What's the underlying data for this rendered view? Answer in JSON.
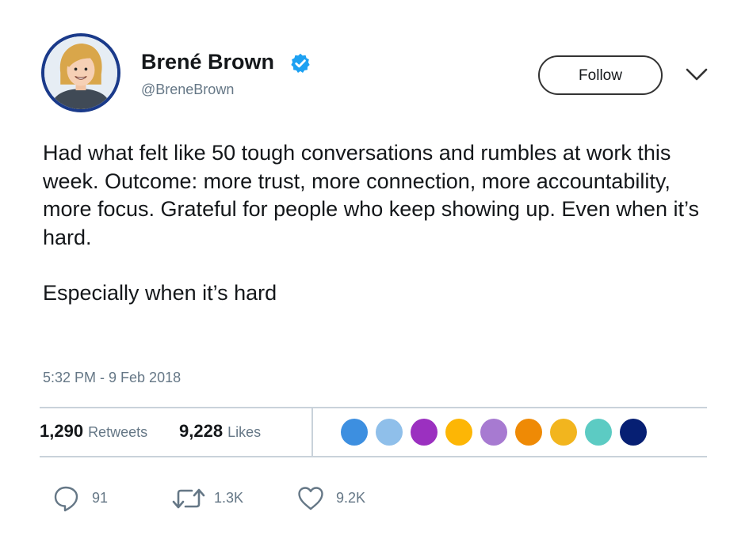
{
  "user": {
    "display_name": "Brené Brown",
    "handle": "@BreneBrown",
    "avatar_icon": "user-avatar-illustration",
    "verified_icon": "verified-badge-icon",
    "verified_color": "#1da1f2"
  },
  "header": {
    "follow_label": "Follow",
    "menu_icon": "chevron-down-icon"
  },
  "tweet": {
    "paragraphs": [
      "Had what felt like 50 tough conversations and rumbles at work this week. Outcome: more trust, more connection, more accountability, more focus. Grateful for people who keep showing up. Even when it’s hard.",
      "Especially when it’s hard"
    ],
    "timestamp": "5:32 PM - 9 Feb 2018"
  },
  "stats": {
    "retweets": {
      "count": "1,290",
      "label": "Retweets"
    },
    "likes": {
      "count": "9,228",
      "label": "Likes"
    },
    "liker_colors": [
      "#3d8fe0",
      "#8fbfea",
      "#9b30c0",
      "#fdb605",
      "#a77ad1",
      "#ef8a05",
      "#f2b51e",
      "#5ccbc3",
      "#061f73"
    ]
  },
  "actions": {
    "reply": {
      "icon": "reply-icon",
      "count": "91"
    },
    "retweet": {
      "icon": "retweet-icon",
      "count": "1.3K"
    },
    "like": {
      "icon": "heart-icon",
      "count": "9.2K"
    }
  },
  "colors": {
    "text": "#14171a",
    "secondary_text": "#657786",
    "divider": "#c9d2da",
    "avatar_border": "#1a3a8a"
  }
}
